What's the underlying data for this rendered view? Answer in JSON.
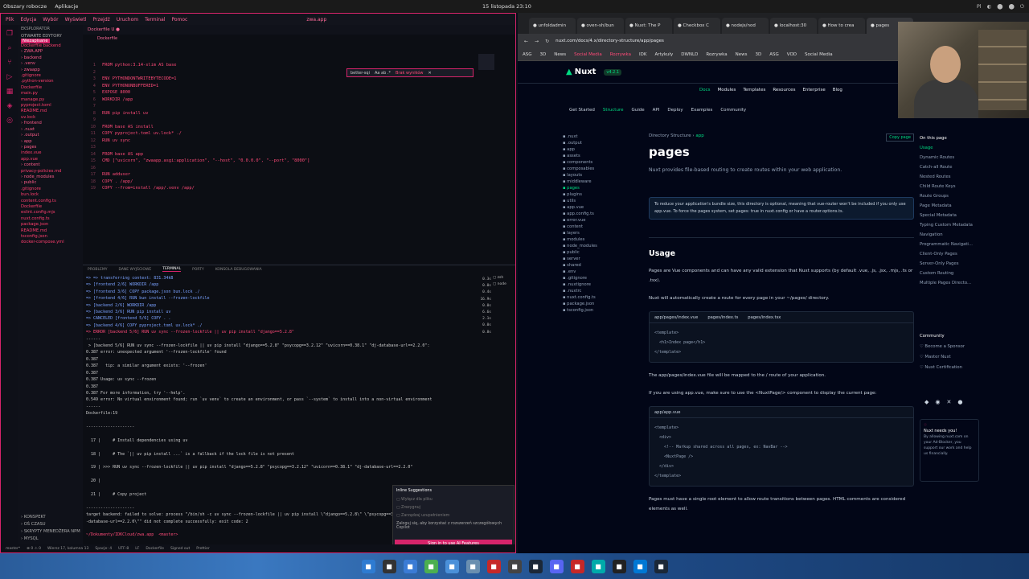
{
  "topbar": {
    "workspace": "Obszary robocze",
    "apps": "Aplikacje",
    "clock": "15 listopada 23:10",
    "tray": [
      "Pl",
      "◐",
      "⬤",
      "⬤",
      "⏻"
    ]
  },
  "vscode": {
    "title_items": [
      "Plik",
      "Edycja",
      "Wybór",
      "Wyświetl",
      "Przejdź",
      "Uruchom",
      "Terminal",
      "Pomoc"
    ],
    "window_title": "zwa.app",
    "tab": "Dockerfile",
    "tab_state": "U",
    "explorer_header": "EKSPLORATOR",
    "open_editors": "OTWARTE EDYTORY",
    "open_badge": "Niezapisane",
    "open_file": "Dockerfile backend",
    "tree": [
      {
        "t": "ZWA.APP",
        "d": 1
      },
      {
        "t": "backend",
        "d": 1
      },
      {
        "t": ".venv",
        "d": 1
      },
      {
        "t": "zwaapp",
        "d": 1
      },
      {
        "t": ".gitignore",
        "d": 0
      },
      {
        "t": ".python-version",
        "d": 0
      },
      {
        "t": "Dockerfile",
        "d": 0
      },
      {
        "t": "main.py",
        "d": 0
      },
      {
        "t": "manage.py",
        "d": 0
      },
      {
        "t": "pyproject.toml",
        "d": 0
      },
      {
        "t": "README.md",
        "d": 0
      },
      {
        "t": "uv.lock",
        "d": 0
      },
      {
        "t": "frontend",
        "d": 1
      },
      {
        "t": ".nuxt",
        "d": 1
      },
      {
        "t": ".output",
        "d": 1
      },
      {
        "t": "app",
        "d": 1
      },
      {
        "t": "pages",
        "d": 1
      },
      {
        "t": "index.vue",
        "d": 0
      },
      {
        "t": "app.vue",
        "d": 0
      },
      {
        "t": "content",
        "d": 1
      },
      {
        "t": "privacy-policies.md",
        "d": 0
      },
      {
        "t": "node_modules",
        "d": 1
      },
      {
        "t": "public",
        "d": 1
      },
      {
        "t": ".gitignore",
        "d": 0
      },
      {
        "t": "bun.lock",
        "d": 0
      },
      {
        "t": "content.config.ts",
        "d": 0
      },
      {
        "t": "Dockerfile",
        "d": 0
      },
      {
        "t": "eslint.config.mjs",
        "d": 0
      },
      {
        "t": "nuxt.config.ts",
        "d": 0
      },
      {
        "t": "package.json",
        "d": 0
      },
      {
        "t": "README.md",
        "d": 0
      },
      {
        "t": "tsconfig.json",
        "d": 0
      },
      {
        "t": "docker-compose.yml",
        "d": 0
      }
    ],
    "outline": [
      "KONSPEKT",
      "OŚ CZASU",
      "SKRYPTY MENEDŻERA NPM",
      "MYSQL"
    ],
    "find": {
      "value": "better-sqi",
      "opts": "Aa ab .*",
      "result": "Brak wyników"
    },
    "code": [
      {
        "n": "1",
        "c": "FROM python:3.14-slim AS base"
      },
      {
        "n": "2",
        "c": ""
      },
      {
        "n": "3",
        "c": "ENV PYTHONDONTWRITEBYTECODE=1"
      },
      {
        "n": "4",
        "c": "ENV PYTHONUNBUFFERED=1"
      },
      {
        "n": "5",
        "c": "EXPOSE 8000"
      },
      {
        "n": "6",
        "c": "WORKDIR /app"
      },
      {
        "n": "7",
        "c": ""
      },
      {
        "n": "8",
        "c": "RUN pip install uv"
      },
      {
        "n": "9",
        "c": ""
      },
      {
        "n": "10",
        "c": "FROM base AS install"
      },
      {
        "n": "11",
        "c": "COPY pyproject.toml uv.lock* ./"
      },
      {
        "n": "12",
        "c": "RUN uv sync"
      },
      {
        "n": "13",
        "c": ""
      },
      {
        "n": "14",
        "c": "FROM base AS app"
      },
      {
        "n": "15",
        "c": "CMD [\"uvicorn\", \"zwaapp.asgi:application\", \"--host\", \"0.0.0.0\", \"--port\", \"8000\"]"
      },
      {
        "n": "16",
        "c": ""
      },
      {
        "n": "17",
        "c": "RUN adduser"
      },
      {
        "n": "18",
        "c": "COPY . /app/"
      },
      {
        "n": "19",
        "c": "COPY --from=install /app/.venv /app/"
      }
    ],
    "panel_tabs": [
      "PROBLEMY",
      "DANE WYJŚCIOWE",
      "TERMINAL",
      "PORTY",
      "KONSOLA DEBUGOWANIA"
    ],
    "terminal": [
      {
        "c": "=> => transferring context: 831.34kB",
        "k": "blue"
      },
      {
        "c": "=> [frontend 2/6] WORKDIR /app",
        "k": "blue"
      },
      {
        "c": "=> [frontend 3/6] COPY package.json bun.lock ./",
        "k": "blue"
      },
      {
        "c": "=> [frontend 4/6] RUN bun install --frozen-lockfile",
        "k": "blue"
      },
      {
        "c": "=> [backend 2/6] WORKDIR /app",
        "k": "blue"
      },
      {
        "c": "=> [backend 3/6] RUN pip install uv",
        "k": "blue"
      },
      {
        "c": "=> CANCELED [frontend 5/6] COPY . .",
        "k": "blue"
      },
      {
        "c": "=> [backend 4/6] COPY pyproject.toml uv.lock* ./",
        "k": "blue"
      },
      {
        "c": "=> ERROR [backend 5/6] RUN uv sync --frozen-lockfile || uv pip install \"django==5.2.8\"",
        "k": "red"
      },
      {
        "c": "------",
        "k": ""
      },
      {
        "c": " > [backend 5/6] RUN uv sync --frozen-lockfile || uv pip install \"django==5.2.8\" \"psycopg==3.2.12\" \"uvicorn==0.38.1\" \"dj-database-url==2.2.0\":",
        "k": ""
      },
      {
        "c": "0.387 error: unexpected argument '--frozen-lockfile' found",
        "k": ""
      },
      {
        "c": "0.387",
        "k": ""
      },
      {
        "c": "0.387   tip: a similar argument exists: '--frozen'",
        "k": ""
      },
      {
        "c": "0.387",
        "k": ""
      },
      {
        "c": "0.387 Usage: uv sync --frozen",
        "k": ""
      },
      {
        "c": "0.387",
        "k": ""
      },
      {
        "c": "0.387 For more information, try '--help'.",
        "k": ""
      },
      {
        "c": "0.549 error: No virtual environment found; run `uv venv` to create an environment, or pass `--system` to install into a non-virtual environment",
        "k": ""
      },
      {
        "c": "------",
        "k": ""
      },
      {
        "c": "Dockerfile:19",
        "k": ""
      },
      {
        "c": "",
        "k": ""
      },
      {
        "c": "--------------------",
        "k": ""
      },
      {
        "c": "",
        "k": ""
      },
      {
        "c": "  17 |     # Install dependencies using uv",
        "k": ""
      },
      {
        "c": "",
        "k": ""
      },
      {
        "c": "  18 |     # The `|| uv pip install ...` is a fallback if the lock file is not present",
        "k": ""
      },
      {
        "c": "",
        "k": ""
      },
      {
        "c": "  19 | >>> RUN uv sync --frozen-lockfile || uv pip install \"django==5.2.8\" \"psycopg==3.2.12\" \"uvicorn==0.38.1\" \"dj-database-url==2.2.0\"",
        "k": ""
      },
      {
        "c": "",
        "k": ""
      },
      {
        "c": "  20 |",
        "k": ""
      },
      {
        "c": "",
        "k": ""
      },
      {
        "c": "  21 |     # Copy project",
        "k": ""
      },
      {
        "c": "",
        "k": ""
      },
      {
        "c": "--------------------",
        "k": ""
      },
      {
        "c": "target backend: failed to solve: process \"/bin/sh -c uv sync --frozen-lockfile || uv pip install \\\"django==5.2.8\\\" \\\"psycopg==3.2.12\\\"",
        "k": ""
      },
      {
        "c": "-database-url==2.2.0\\\"\" did not complete successfully: exit code: 2",
        "k": ""
      },
      {
        "c": "",
        "k": ""
      },
      {
        "c": "~/Dokumenty/IDKCloud/zwa.app  <master>",
        "k": "red"
      }
    ],
    "timings": [
      "0.3s",
      "0.0s",
      "0.4s",
      "16.9s",
      "0.0s",
      "6.6s",
      "2.1s",
      "0.0s",
      "0.8s"
    ],
    "shells": [
      "zsh",
      "node"
    ],
    "copilot": {
      "title": "Inline Suggestions",
      "items": [
        "Wyłącz dla pliku",
        "Zrezygnuj",
        "Zarządzaj uzupełnieniem"
      ],
      "msg": "Zaloguj się, aby korzystać z rozszerzeń szczegółowych Copilot",
      "button": "Sign in to use AI Features"
    },
    "status": [
      "master*",
      "⊗ 0 ⚠ 0",
      "Wiersz 17, kolumna 13",
      "Spacje: 4",
      "UTF-8",
      "LF",
      "Dockerfile",
      "Signed out",
      "Prettier"
    ]
  },
  "browser": {
    "tabs": [
      "unfoldadmin",
      "oven-sh/bun",
      "Nuxt: The P",
      "Checkbox C",
      "nodejs/nod",
      "localhost:30",
      "How to crea",
      "pages"
    ],
    "url": "nuxt.com/docs/4.x/directory-structure/app/pages",
    "bookmarks": [
      "ASG",
      "3D",
      "News",
      "Social Media",
      "Rozrywka",
      "IDK",
      "Artykuły",
      "DWNLD",
      "Rozrywka",
      "News",
      "3D",
      "ASG",
      "VOD",
      "Social Media"
    ],
    "nuxt": {
      "logo": "Nuxt",
      "version": "v4.2.1",
      "topnav": [
        "Docs",
        "Modules",
        "Templates",
        "Resources",
        "Enterprise",
        "Blog"
      ],
      "subnav": [
        "Get Started",
        "Structure",
        "Guide",
        "API",
        "Deploy",
        "Examples",
        "Community"
      ],
      "tree": [
        ".nuxt",
        ".output",
        "app",
        "assets",
        "components",
        "composables",
        "layouts",
        "middleware",
        "pages",
        "plugins",
        "utils",
        "app.vue",
        "app.config.ts",
        "error.vue",
        "content",
        "layers",
        "modules",
        "node_modules",
        "public",
        "server",
        "shared",
        ".env",
        ".gitignore",
        ".nuxtignore",
        ".nuxtrc",
        "nuxt.config.ts",
        "package.json",
        "tsconfig.json"
      ],
      "crumb_a": "Directory Structure",
      "crumb_b": "app",
      "copy": "Copy page",
      "h1": "pages",
      "lead": "Nuxt provides file-based routing to create routes within your web application.",
      "note": "To reduce your application's bundle size, this directory is optional, meaning that vue-router won't be included if you only use app.vue. To force the pages system, set pages: true in nuxt.config or have a router.options.ts.",
      "h2": "Usage",
      "p1": "Pages are Vue components and can have any valid extension that Nuxt supports (by default .vue, .js, .jsx, .mjs, .ts or .tsx).",
      "p2": "Nuxt will automatically create a route for every page in your ~/pages/ directory.",
      "code1_tabs": [
        "app/pages/index.vue",
        "pages/index.ts",
        "pages/index.tsx"
      ],
      "code1": "<template>\n  <h1>Index page</h1>\n</template>",
      "p3": "The app/pages/index.vue file will be mapped to the / route of your application.",
      "p4": "If you are using app.vue, make sure to use the <NuxtPage/> component to display the current page:",
      "code2_tab": "app/app.vue",
      "code2": "<template>\n  <div>\n    <!-- Markup shared across all pages, ex: NavBar -->\n    <NuxtPage />\n  </div>\n</template>",
      "p5": "Pages must have a single root element to allow route transitions between pages. HTML comments are considered elements as well.",
      "toc_hdr": "On this page",
      "toc": [
        "Usage",
        "Dynamic Routes",
        "Catch-all Route",
        "Nested Routes",
        "Child Route Keys",
        "Route Groups",
        "Page Metadata",
        "Special Metadata",
        "Typing Custom Metadata",
        "Navigation",
        "Programmatic Navigati...",
        "Client-Only Pages",
        "Server-Only Pages",
        "Custom Routing",
        "Multiple Pages Directo..."
      ],
      "community_hdr": "Community",
      "community": [
        "Become a Sponsor",
        "Master Nuxt",
        "Nuxt Certification"
      ],
      "ad_title": "Nuxt needs you!",
      "ad_text": "By allowing nuxt.com on your Ad-Blocker, you support our work and help us financially."
    }
  },
  "taskbar": [
    "files",
    "term",
    "apps",
    "chrome",
    "folder",
    "notes",
    "red",
    "spt",
    "steam2",
    "discord",
    "check",
    "vm",
    "obs",
    "code",
    "steam"
  ],
  "colors": {
    "accent": "#d6246a",
    "nuxt": "#00dc82"
  }
}
